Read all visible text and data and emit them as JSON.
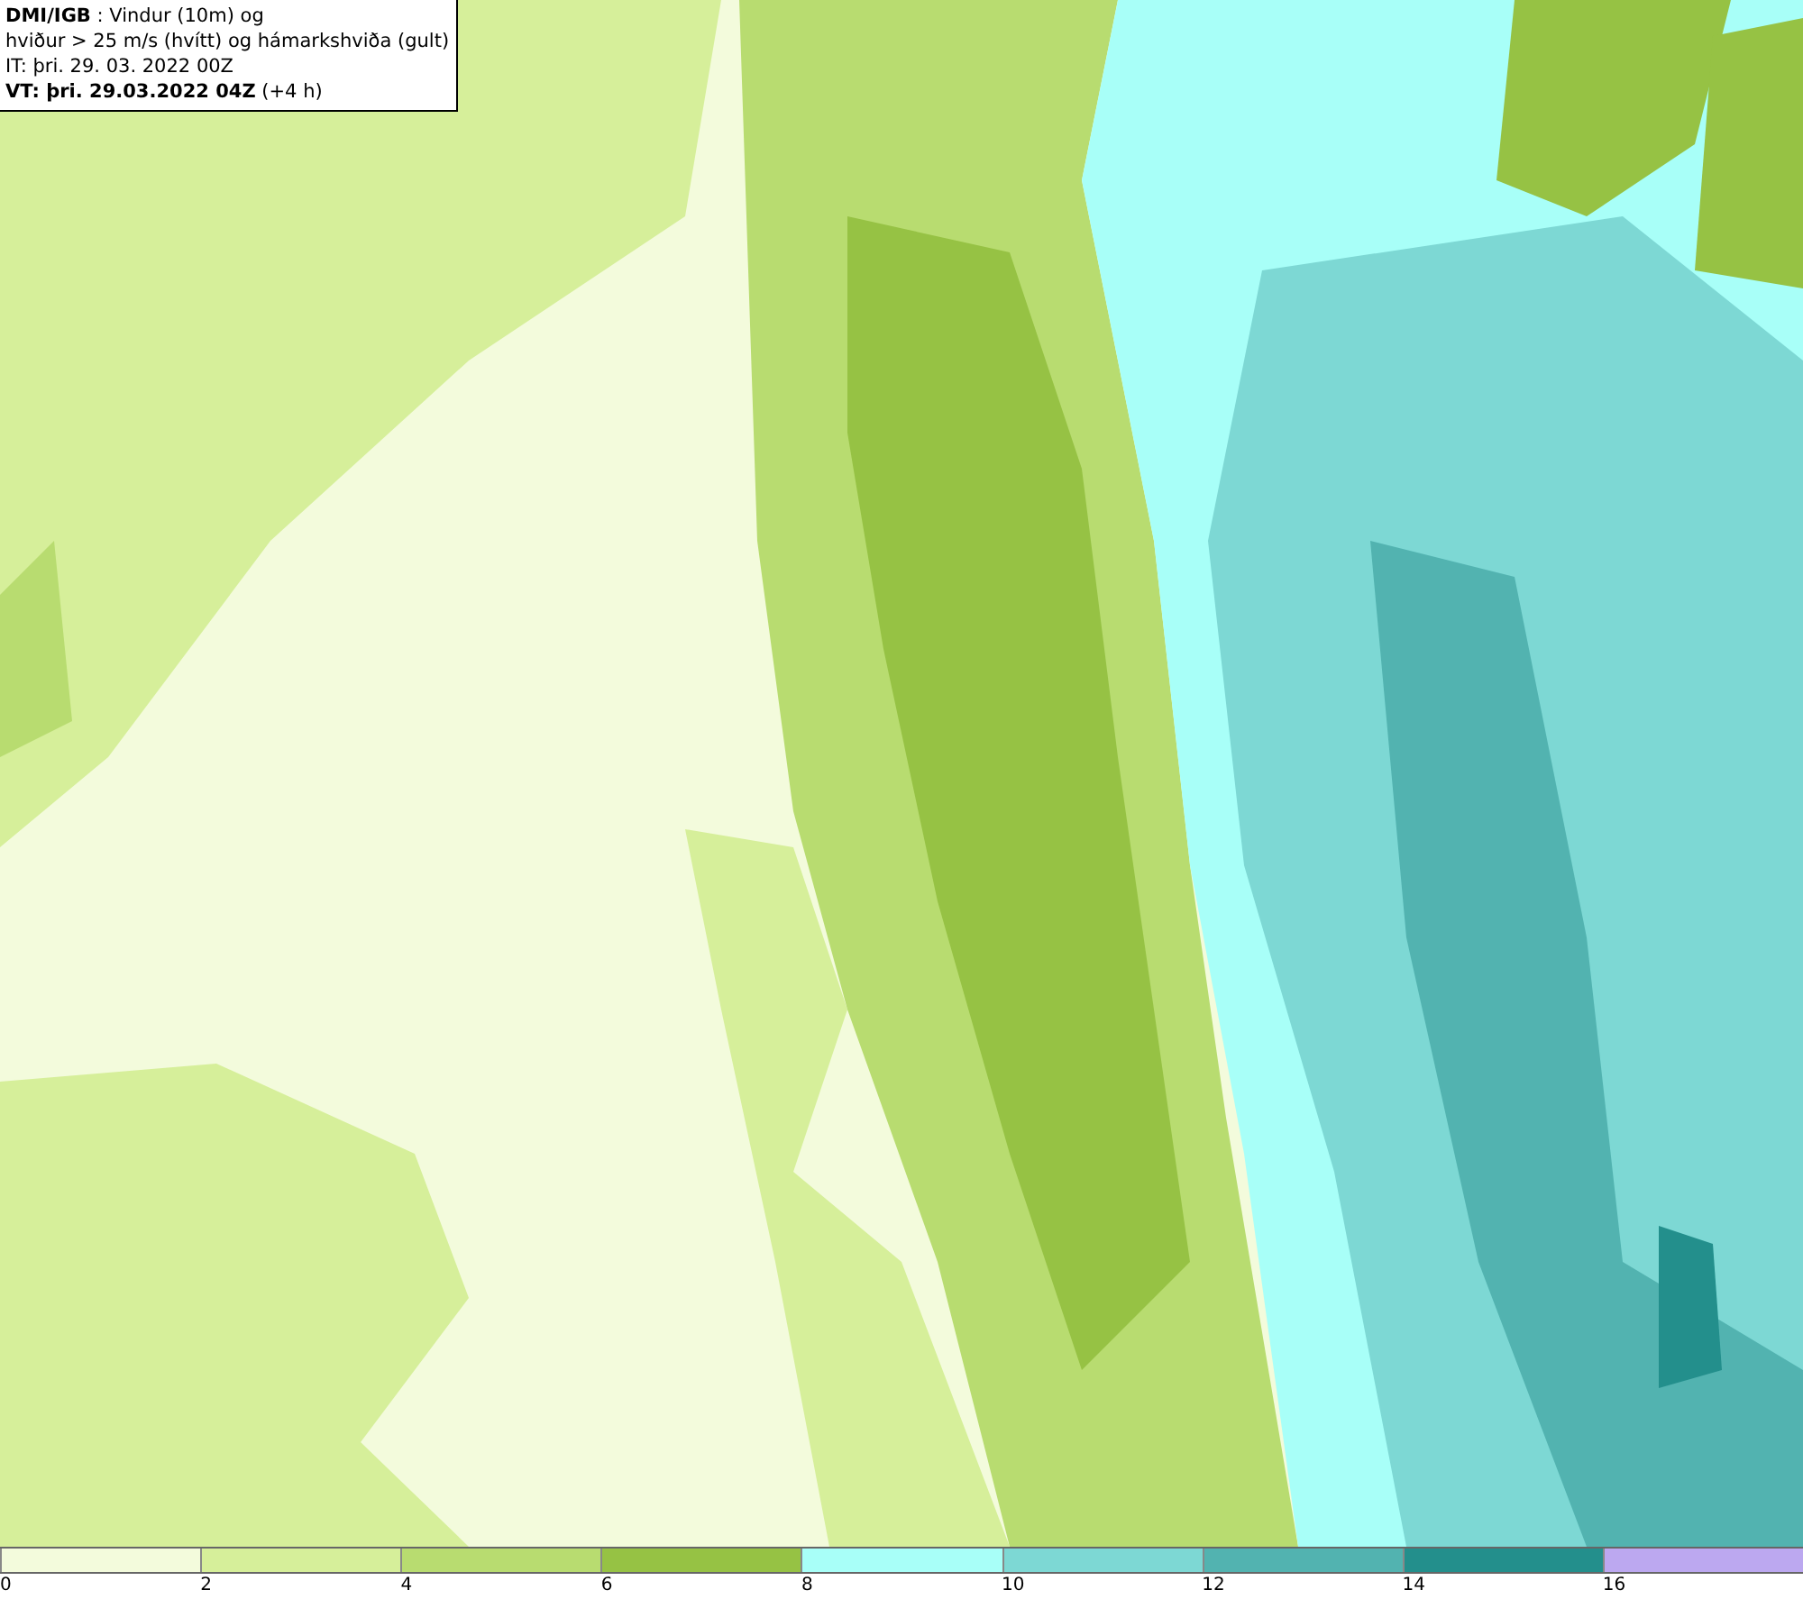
{
  "title_box": {
    "lines": [
      "**DMI/IGB** : Vindur (10m) og",
      "hviður > 25 m/s (hvítt) og hámarkshviða (gult)",
      "IT: þri. 29. 03. 2022 00Z",
      "**VT: þri. 29.03.2022 04Z** (+4 h)"
    ]
  },
  "legend": {
    "bins": [
      {
        "color": "#f3fbdc"
      },
      {
        "color": "#d6ef9a"
      },
      {
        "color": "#b8dc70"
      },
      {
        "color": "#96c244"
      },
      {
        "color": "#a8fff8"
      },
      {
        "color": "#7dd8d4"
      },
      {
        "color": "#52b3b0"
      },
      {
        "color": "#238f8c"
      },
      {
        "color": "#bca8f0"
      }
    ],
    "labels": [
      "0",
      "2",
      "4",
      "6",
      "8",
      "10",
      "12",
      "14",
      "16"
    ]
  }
}
